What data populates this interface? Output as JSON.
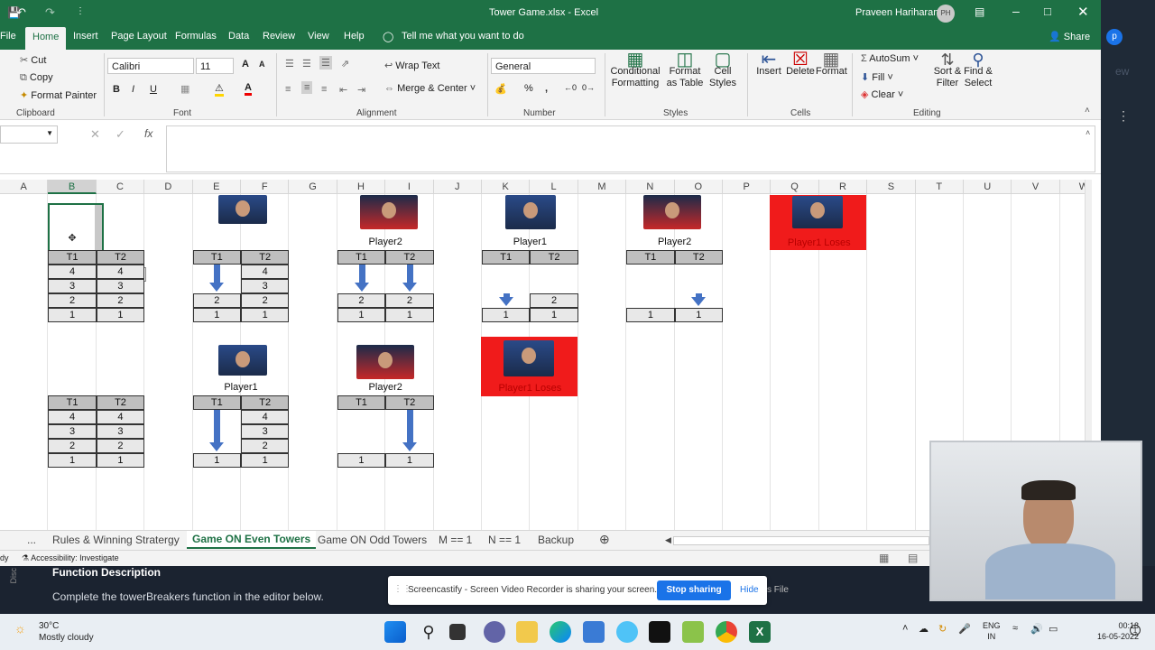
{
  "window": {
    "title": "Tower Game.xlsx  -  Excel",
    "user": "Praveen Hariharan",
    "user_initials": "PH"
  },
  "tabs": [
    "File",
    "Home",
    "Insert",
    "Page Layout",
    "Formulas",
    "Data",
    "Review",
    "View",
    "Help"
  ],
  "tell_me": "Tell me what you want to do",
  "share": "Share",
  "ribbon": {
    "clipboard": {
      "cut": "Cut",
      "copy": "Copy",
      "format_painter": "Format Painter",
      "group": "Clipboard"
    },
    "font": {
      "name": "Calibri",
      "size": "11",
      "group": "Font",
      "bold": "B",
      "italic": "I",
      "underline": "U"
    },
    "alignment": {
      "wrap": "Wrap Text",
      "merge": "Merge & Center",
      "group": "Alignment"
    },
    "number": {
      "format": "General",
      "group": "Number"
    },
    "styles": {
      "cond": "Conditional Formatting",
      "table": "Format as Table",
      "cell": "Cell Styles",
      "group": "Styles"
    },
    "cells": {
      "insert": "Insert",
      "delete": "Delete",
      "format": "Format",
      "group": "Cells"
    },
    "editing": {
      "autosum": "AutoSum",
      "fill": "Fill",
      "clear": "Clear",
      "sort": "Sort & Filter",
      "find": "Find & Select",
      "group": "Editing"
    }
  },
  "columns": [
    "A",
    "B",
    "C",
    "D",
    "E",
    "F",
    "G",
    "H",
    "I",
    "J",
    "K",
    "L",
    "M",
    "N",
    "O",
    "P",
    "Q",
    "R",
    "S",
    "T",
    "U",
    "V",
    "W"
  ],
  "grid": {
    "players": [
      "Player2",
      "Player1",
      "Player2",
      "Player1",
      "Player2"
    ],
    "loses": [
      "Player1 Loses",
      "Player1 Loses"
    ],
    "header": [
      "T1",
      "T2"
    ],
    "tables": [
      {
        "t1": [
          "4",
          "3",
          "2",
          "1"
        ],
        "t2": [
          "4",
          "3",
          "2",
          "1"
        ]
      },
      {
        "t1": [
          "2",
          "1"
        ],
        "t2": [
          "4",
          "3",
          "2",
          "1"
        ]
      },
      {
        "t1": [
          "2",
          "1"
        ],
        "t2": [
          "2",
          "1"
        ]
      },
      {
        "t1": [
          "1"
        ],
        "t2": [
          "2",
          "1"
        ]
      },
      {
        "t1": [
          "1"
        ],
        "t2": [
          "1"
        ]
      },
      {
        "t1": [
          "4",
          "3",
          "2",
          "1"
        ],
        "t2": [
          "4",
          "3",
          "2",
          "1"
        ]
      },
      {
        "t1": [
          "1"
        ],
        "t2": [
          "4",
          "3",
          "2",
          "1"
        ]
      },
      {
        "t1": [
          "1"
        ],
        "t2": [
          "1"
        ]
      }
    ]
  },
  "sheets": [
    "Rules & Winning Stratergy",
    "Game ON Even Towers",
    "Game ON Odd Towers",
    "M == 1",
    "N == 1",
    "Backup"
  ],
  "status": {
    "accessibility": "Accessibility: Investigate",
    "ready": "dy"
  },
  "behind": {
    "heading": "Function Description",
    "text": "Complete the towerBreakers function in the editor below.",
    "file": "s File"
  },
  "screencastify": {
    "message": "Screencastify - Screen Video Recorder is sharing your screen.",
    "stop": "Stop sharing",
    "hide": "Hide"
  },
  "weather": {
    "temp": "30°C",
    "desc": "Mostly cloudy"
  },
  "tray": {
    "lang": "ENG",
    "region": "IN",
    "time": "00:18",
    "date": "16-05-2022",
    "badge": "1"
  },
  "colors": {
    "excel_green": "#1e7145",
    "red": "#f01b1b",
    "arrow_blue": "#4472c4",
    "stop_blue": "#1a73e8"
  }
}
